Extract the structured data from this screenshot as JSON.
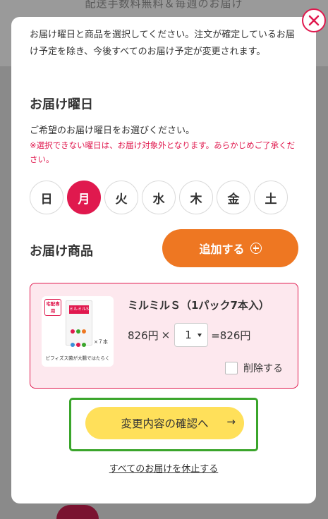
{
  "background": {
    "top_text": "配送手数料無料＆毎週のお届け"
  },
  "modal": {
    "intro_text": "お届け曜日と商品を選択してください。注文が確定しているお届け予定を除き、今後すべてのお届け予定が変更されます。",
    "delivery_day": {
      "title": "お届け曜日",
      "hint": "ご希望のお届け曜日をお選びください。",
      "warning": "※選択できない曜日は、お届け対象外となります。あらかじめご了承ください。",
      "days": [
        "日",
        "月",
        "火",
        "水",
        "木",
        "金",
        "土"
      ],
      "selected_day": "月"
    },
    "products": {
      "title": "お届け商品",
      "add_button_label": "追加する",
      "items": [
        {
          "badge": "宅配専用",
          "pack_label": "ミルミルS",
          "pack_count": "×７本",
          "image_caption": "ビフィズス菌が大腸ではたらく",
          "name": "ミルミルＳ（1パック7本入）",
          "unit_price": "826円",
          "times": "×",
          "quantity": "1",
          "total": "=826円",
          "delete_label": "削除する"
        }
      ]
    },
    "confirm_button_label": "変更内容の確認へ",
    "confirm_arrow": "→",
    "suspend_link": "すべてのお届けを休止する"
  },
  "colors": {
    "accent_red": "#e0194e",
    "add_orange": "#ee7722",
    "confirm_yellow": "#ffe05a",
    "highlight_green": "#3aa52b",
    "card_pink": "#fde8ee"
  },
  "icons": {
    "close": "close-icon",
    "add": "plus-circle-icon",
    "dropdown": "caret-down-icon",
    "confirm": "arrow-right-icon"
  }
}
